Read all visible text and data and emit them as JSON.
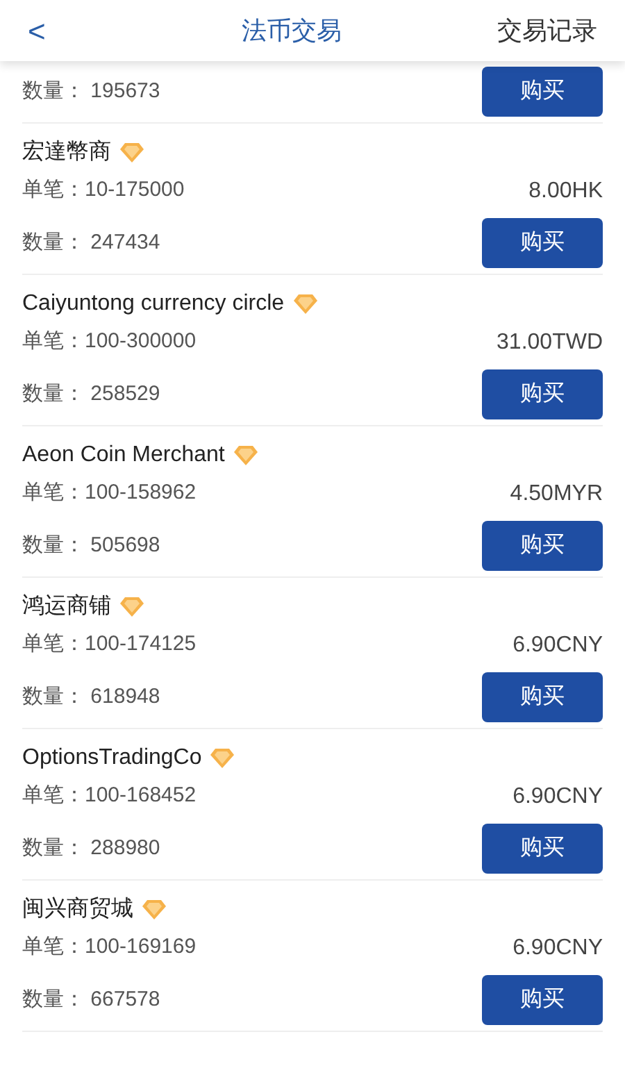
{
  "header": {
    "back": "<",
    "title": "法币交易",
    "action": "交易记录"
  },
  "offers": [
    {
      "quantity_label": "数量：",
      "quantity": "195673",
      "button": "购买"
    },
    {
      "name": "宏達幣商",
      "range_label": "单笔：",
      "range": "10-175000",
      "price": "8.00HK",
      "quantity_label": "数量：",
      "quantity": "247434",
      "button": "购买"
    },
    {
      "name": "Caiyuntong currency circle",
      "range_label": "单笔：",
      "range": "100-300000",
      "price": "31.00TWD",
      "quantity_label": "数量：",
      "quantity": "258529",
      "button": "购买"
    },
    {
      "name": "Aeon Coin Merchant",
      "range_label": "单笔：",
      "range": "100-158962",
      "price": "4.50MYR",
      "quantity_label": "数量：",
      "quantity": "505698",
      "button": "购买"
    },
    {
      "name": "鸿运商铺",
      "range_label": "单笔：",
      "range": "100-174125",
      "price": "6.90CNY",
      "quantity_label": "数量：",
      "quantity": "618948",
      "button": "购买"
    },
    {
      "name": "OptionsTradingCo",
      "range_label": "单笔：",
      "range": "100-168452",
      "price": "6.90CNY",
      "quantity_label": "数量：",
      "quantity": "288980",
      "button": "购买"
    },
    {
      "name": "闽兴商贸城",
      "range_label": "单笔：",
      "range": "100-169169",
      "price": "6.90CNY",
      "quantity_label": "数量：",
      "quantity": "667578",
      "button": "购买"
    }
  ]
}
